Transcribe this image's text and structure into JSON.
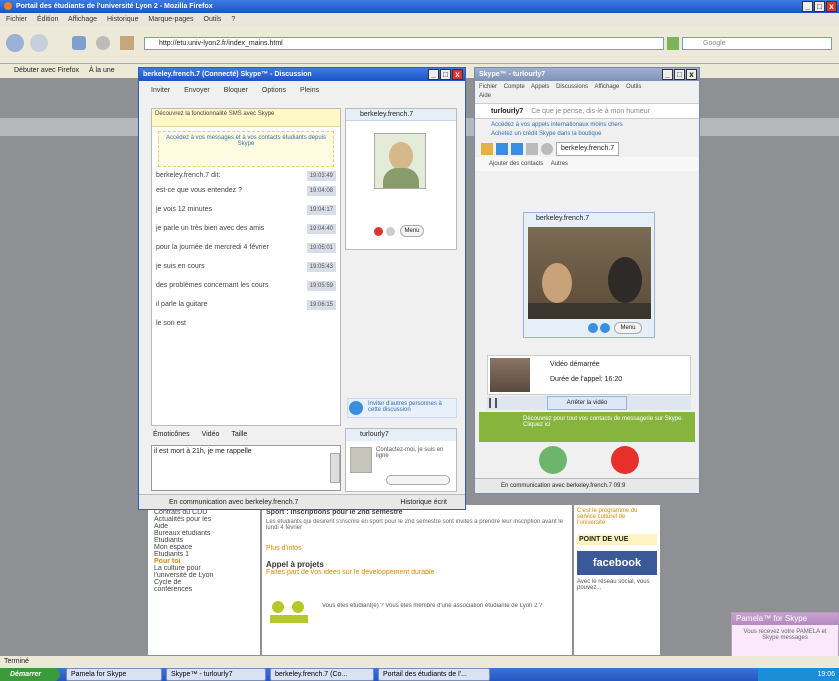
{
  "browser": {
    "title": "Portail des étudiants de l'université Lyon 2 - Mozilla Firefox",
    "menu": [
      "Fichier",
      "Édition",
      "Affichage",
      "Historique",
      "Marque-pages",
      "Outils",
      "?"
    ],
    "url": "http://etu.univ-lyon2.fr/index_mains.html",
    "search_placeholder": "Google",
    "bookmarks": [
      "Débuter avec Firefox",
      "À la une"
    ],
    "status": "Terminé"
  },
  "call_window": {
    "title": "berkeley.french.7 (Connecté) Skype™ - Discussion",
    "toolbar": [
      "Inviter",
      "Envoyer",
      "Bloquer",
      "Options",
      "Pleins"
    ],
    "notice": "Découvrez la fonctionnalité SMS avec Skype",
    "promo": "Accédez à vos messages et à vos contacts étudiants depuis Skype",
    "participants_header": "berkeley.french.7",
    "chat_lines": [
      {
        "text": "berkeley.french.7 dit:",
        "time": "19:03:49"
      },
      {
        "text": "est-ce que vous entendez ?",
        "time": "19:04:08"
      },
      {
        "text": "je vois 12 minutes",
        "time": "19:04:17"
      },
      {
        "text": "je parle un très bien avec des amis",
        "time": "19:04:40"
      },
      {
        "text": "pour la journée de mercredi 4 février",
        "time": "19:05:01"
      },
      {
        "text": "je suis en cours",
        "time": "19:05:43"
      },
      {
        "text": "des problèmes concernant les cours",
        "time": "19:05:59"
      },
      {
        "text": "il parle la guitare",
        "time": "19:06:15"
      },
      {
        "text": "le son est"
      }
    ],
    "side_menu_label": "Menu",
    "invite_text": "Inviter d'autres personnes à cette discussion",
    "format_bar": [
      "Émoticônes",
      "Vidéo",
      "Taille"
    ],
    "input_value": "il est mort à 21h, je me rappelle",
    "second_participant": "turlourly7",
    "second_participant_status": "Contactez-moi, je suis en ligne",
    "status_bar": "En communication avec berkeley.french.7",
    "history_label": "Historique écrit"
  },
  "skype_main": {
    "title": "Skype™ - turlourly7",
    "menu": [
      "Fichier",
      "Compte",
      "Appels",
      "Discussions",
      "Affichage",
      "Outils",
      "Aide"
    ],
    "user": "turlourly7",
    "mood": "Ce que je pense, dis-le à mon humeur",
    "links": [
      "Accédez à vos appels internationaux moins chers",
      "Achetez un crédit Skype dans la boutique"
    ],
    "active_tab": "berkeley.french.7",
    "add_contact": "Ajouter des contacts",
    "more": "Autres",
    "video_name": "berkeley.french.7",
    "video_menu": "Menu",
    "call_mode": "Vidéo démarrée",
    "call_duration": "Durée de l'appel: 16:20",
    "send_video": "Arrêter la vidéo",
    "promo": "Découvrez pour tout vos contacts de messagerie sur Skype. Cliquez ici",
    "status_bar": "En communication avec berkeley.french.7 09:9"
  },
  "page": {
    "left_links": [
      "Contrats du CDD",
      "Actualités pour les",
      "Aide",
      "Bureaux étudiants",
      "Étudiants",
      "Mon espace",
      "Étudiants 1",
      "Pour toi",
      "La culture pour",
      "l'université de Lyon",
      "Cycle de",
      "conférences"
    ],
    "news_title": "Sport : inscriptions pour le 2nd semestre",
    "news_text": "Les étudiants qui désirent s'inscrire en sport pour le 2nd semestre sont invités à prendre leur inscription avant le lundi 4 février",
    "more_info": "Plus d'infos",
    "right_col": [
      "C'est le programme du service culturel de",
      "l'université"
    ],
    "point_de_vue": "POINT DE VUE",
    "facebook": "facebook",
    "fb_text": "Avec le réseau social, vous pouvez...",
    "appel_title": "Appel à projets",
    "appel_subtitle": "Faites part de vos idées sur le développement durable",
    "appel_text": "Vous êtes étudiant(e) ? Vous êtes membre d'une association étudiante de Lyon 2 ?",
    "pamela_title": "Pamela™ for Skype",
    "pamela_text": "Vous recevez votre PAMELA et Skype messages"
  },
  "taskbar": {
    "start": "Démarrer",
    "items": [
      "Pamela for Skype",
      "Skype™ - turlourly7",
      "berkeley.french.7 (Co...",
      "Portail des étudiants de l'..."
    ],
    "clock": "19:06"
  }
}
